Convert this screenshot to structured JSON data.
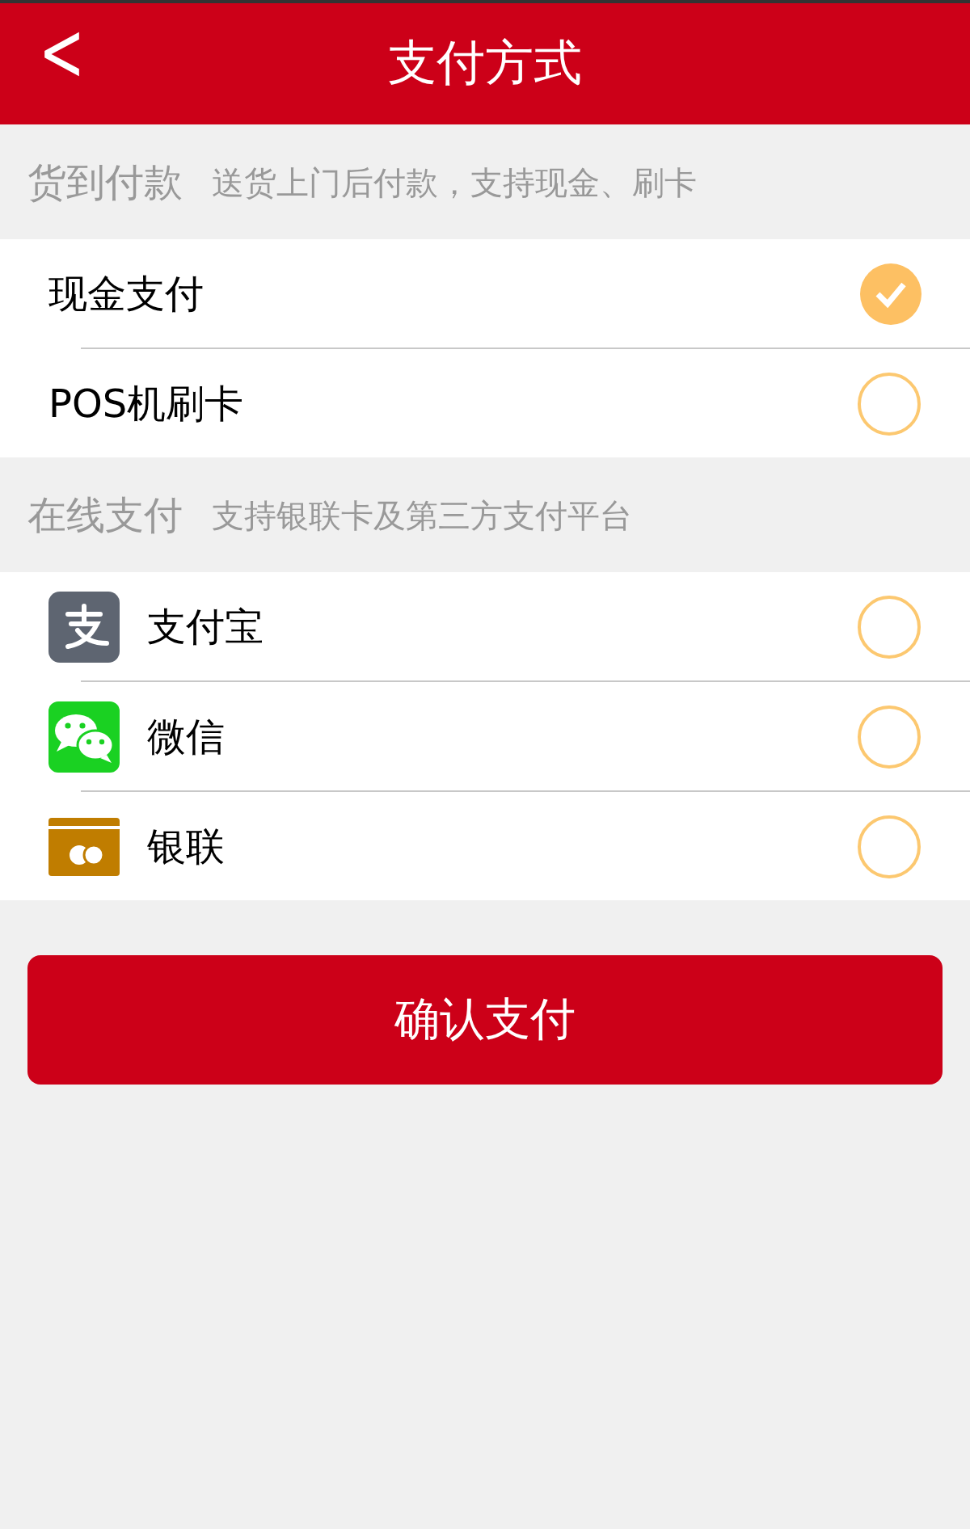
{
  "header": {
    "back": "<",
    "title": "支付方式"
  },
  "sections": [
    {
      "title": "货到付款",
      "description": "送货上门后付款，支持现金、刷卡",
      "options": [
        {
          "kind": "text",
          "label": "现金支付",
          "selected": true
        },
        {
          "kind": "text",
          "label": "POS机刷卡",
          "selected": false
        }
      ]
    },
    {
      "title": "在线支付",
      "description": "支持银联卡及第三方支付平台",
      "options": [
        {
          "kind": "app",
          "label": "支付宝",
          "selected": false
        },
        {
          "kind": "chat",
          "label": "微信",
          "selected": false
        },
        {
          "kind": "card",
          "label": "银联",
          "selected": false
        }
      ]
    }
  ],
  "confirm_button": "确认支付"
}
